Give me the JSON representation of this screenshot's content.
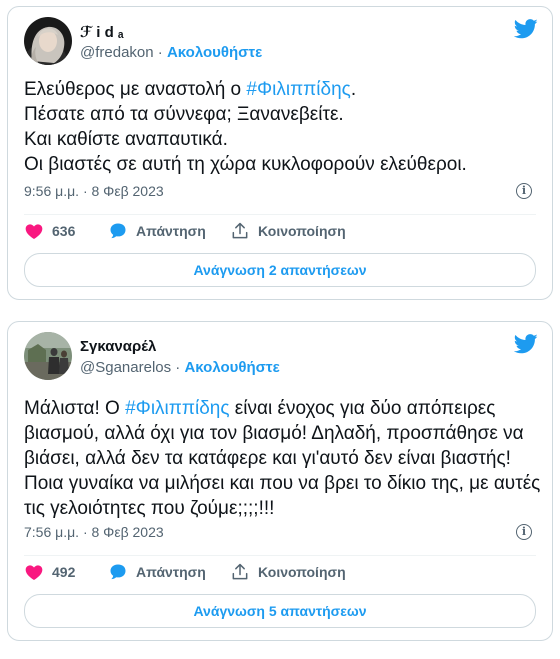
{
  "tweets": [
    {
      "display_name": "ℱ i d ₐ",
      "handle": "@fredakon",
      "separator": "·",
      "follow_label": "Ακολουθήστε",
      "text_before": "Ελεύθερος με αναστολή ο ",
      "hashtag": "#Φιλιππίδης",
      "text_after": ".\nΠέσατε από τα σύννεφα; Ξανανεβείτε.\nΚαι καθίστε αναπαυτικά.\nΟι βιαστές σε αυτή τη χώρα κυκλοφορούν ελεύθεροι.",
      "timestamp": "9:56 μ.μ. · 8 Φεβ 2023",
      "likes": "636",
      "reply_label": "Απάντηση",
      "share_label": "Κοινοποίηση",
      "read_replies_label": "Ανάγνωση 2 απαντήσεων"
    },
    {
      "display_name": "Σγκαναρέλ",
      "handle": "@Sganarelos",
      "separator": "·",
      "follow_label": "Ακολουθήστε",
      "text_before": "Μάλιστα! Ο ",
      "hashtag": "#Φιλιππίδης",
      "text_after": " είναι ένοχος για δύο απόπειρες βιασμού, αλλά όχι για τον βιασμό! Δηλαδή, προσπάθησε να βιάσει, αλλά δεν τα κατάφερε και γι'αυτό δεν είναι βιαστής! Ποια γυναίκα να μιλήσει και που να βρει το δίκιο της, με αυτές τις γελοιότητες που ζούμε;;;;!!!",
      "timestamp": "7:56 μ.μ. · 8 Φεβ 2023",
      "likes": "492",
      "reply_label": "Απάντηση",
      "share_label": "Κοινοποίηση",
      "read_replies_label": "Ανάγνωση 5 απαντήσεων"
    }
  ],
  "icons": {
    "brand": "twitter-bird-icon",
    "like": "heart-icon",
    "reply": "speech-bubble-icon",
    "share": "share-upload-icon",
    "info": "info-icon"
  },
  "colors": {
    "accent": "#1d9bf0",
    "like": "#f91880",
    "text": "#0f1419",
    "muted": "#536471",
    "border": "#cfd9de"
  }
}
